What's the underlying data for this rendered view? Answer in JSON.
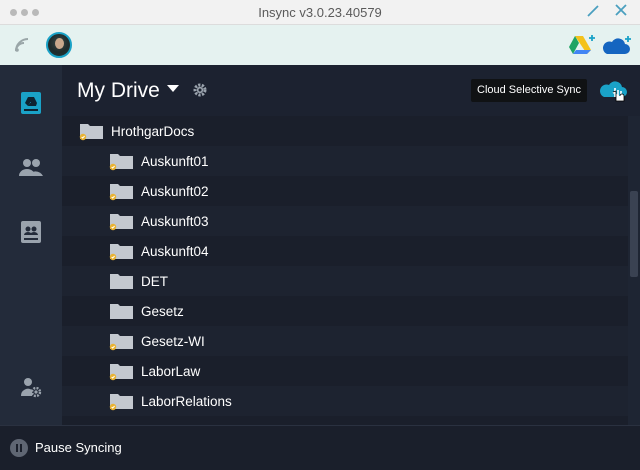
{
  "window": {
    "title": "Insync v3.0.23.40579",
    "minimize_label": "+",
    "close_label": "✕"
  },
  "toolbar": {
    "icons": [
      "wifi-icon",
      "avatar",
      "google-drive-add-icon",
      "onedrive-add-icon"
    ]
  },
  "sidebar": {
    "items": [
      {
        "name": "my-drive",
        "icon": "drive-icon",
        "active": true
      },
      {
        "name": "shared",
        "icon": "people-icon",
        "active": false
      },
      {
        "name": "team-drives",
        "icon": "team-drive-icon",
        "active": false
      },
      {
        "name": "account-settings",
        "icon": "user-gear-icon",
        "active": false
      }
    ]
  },
  "header": {
    "title": "My Drive",
    "tooltip": "Cloud Selective Sync"
  },
  "files": {
    "root": "HrothgarDocs",
    "items": [
      "Auskunft01",
      "Auskunft02",
      "Auskunft03",
      "Auskunft04",
      "DET",
      "Gesetz",
      "Gesetz-WI",
      "LaborLaw",
      "LaborRelations"
    ]
  },
  "footer": {
    "pause_label": "Pause Syncing"
  },
  "colors": {
    "accent": "#1aa2c7",
    "sync_badge": "#e8b230",
    "folder": "#c3c8cf"
  }
}
